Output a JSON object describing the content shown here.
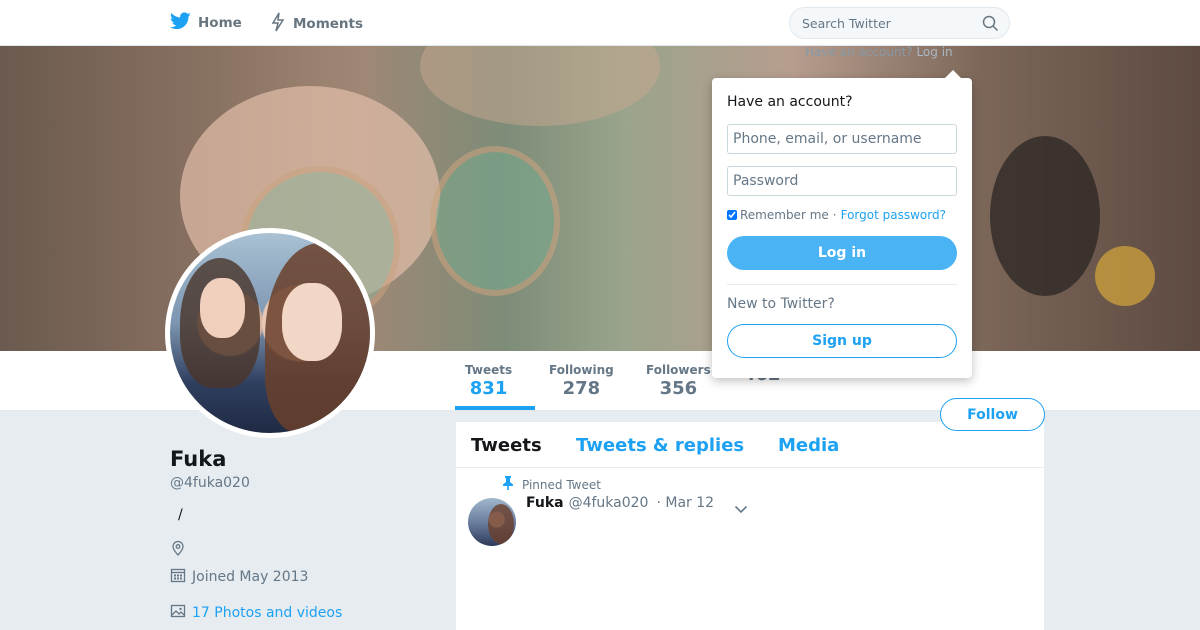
{
  "nav": {
    "home_label": "Home",
    "moments_label": "Moments",
    "search_placeholder": "Search Twitter",
    "have_account_prompt": "Have an account?",
    "login_link": "Log in"
  },
  "profile": {
    "name": "Fuka",
    "handle": "@4fuka020",
    "bio": "/",
    "location": "",
    "joined": "Joined May 2013",
    "photos_videos": "17 Photos and videos",
    "follow_label": "Follow"
  },
  "stats": [
    {
      "label": "Tweets",
      "value": "831"
    },
    {
      "label": "Following",
      "value": "278"
    },
    {
      "label": "Followers",
      "value": "356"
    },
    {
      "label": "",
      "value": "462"
    }
  ],
  "timeline": {
    "tabs": [
      {
        "label": "Tweets"
      },
      {
        "label": "Tweets & replies"
      },
      {
        "label": "Media"
      }
    ],
    "pinned_label": "Pinned Tweet",
    "tweet": {
      "name": "Fuka",
      "handle": "@4fuka020",
      "date": "· Mar 12"
    }
  },
  "login_dropdown": {
    "title": "Have an account?",
    "username_placeholder": "Phone, email, or username",
    "password_placeholder": "Password",
    "remember_me": "Remember me",
    "separator": "·",
    "forgot_password": "Forgot password?",
    "login_button": "Log in",
    "new_prompt": "New to Twitter?",
    "signup_button": "Sign up"
  },
  "colors": {
    "accent": "#1da1f2",
    "login_button": "#4ab3f4",
    "background": "#e6ecf0"
  },
  "icons": [
    "twitter-bird-icon",
    "lightning-icon",
    "search-icon",
    "pin-icon",
    "location-icon",
    "calendar-icon",
    "image-icon",
    "chevron-down-icon"
  ]
}
